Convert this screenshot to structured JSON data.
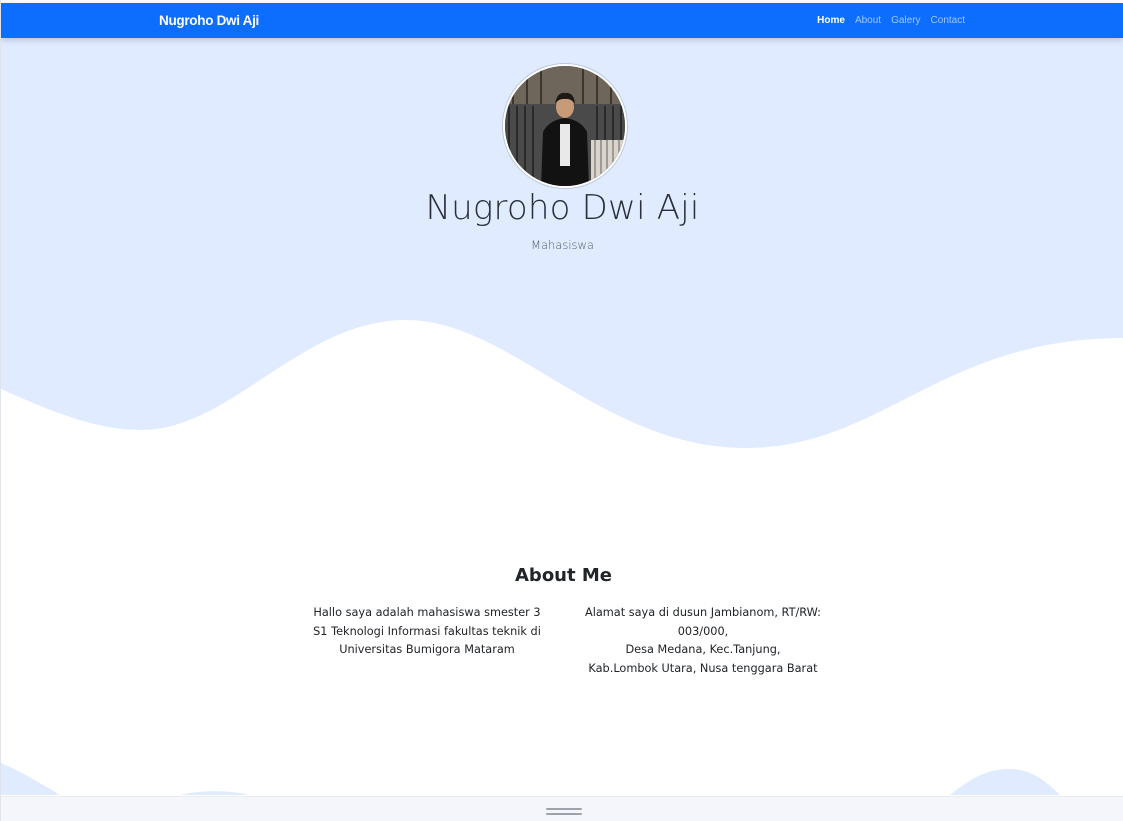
{
  "navbar": {
    "brand": "Nugroho Dwi Aji",
    "links": [
      {
        "label": "Home",
        "active": true
      },
      {
        "label": "About",
        "active": false
      },
      {
        "label": "Galery",
        "active": false
      },
      {
        "label": "Contact",
        "active": false
      }
    ]
  },
  "hero": {
    "name": "Nugroho Dwi Aji",
    "subtitle": "Mahasiswa",
    "avatar_icon": "profile-photo"
  },
  "about": {
    "title": "About Me",
    "left_lines": [
      "Hallo saya adalah mahasiswa smester 3",
      "S1 Teknologi Informasi fakultas teknik di",
      "Universitas Bumigora Mataram"
    ],
    "right_lines": [
      "Alamat saya di dusun Jambianom, RT/RW:",
      "003/000,",
      "Desa Medana, Kec.Tanjung,",
      "Kab.Lombok Utara, Nusa tenggara Barat"
    ]
  },
  "colors": {
    "navbar": "#0d6efd",
    "hero_background": "#e0ebff",
    "page_background": "#ffffff",
    "text": "#212529"
  }
}
